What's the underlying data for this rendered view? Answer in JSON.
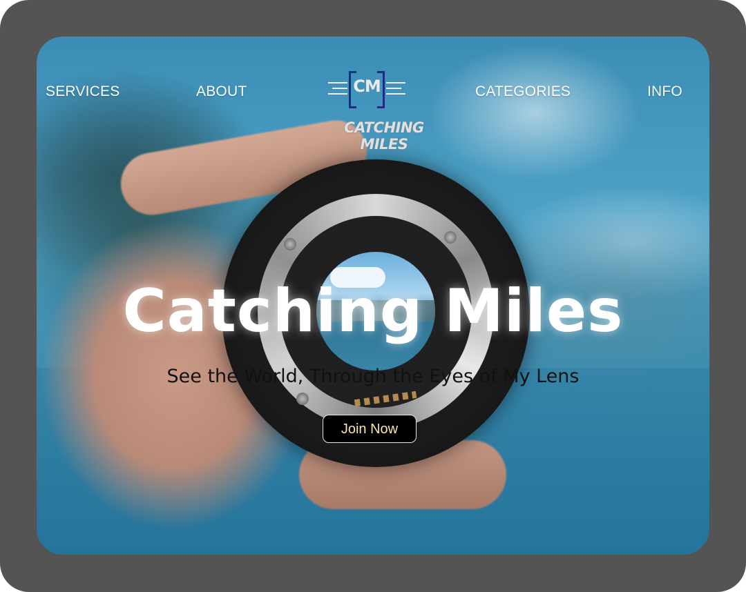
{
  "nav": {
    "items": [
      {
        "label": "SERVICES"
      },
      {
        "label": "ABOUT"
      },
      {
        "label": "CATEGORIES"
      },
      {
        "label": "INFO"
      }
    ]
  },
  "logo": {
    "initials": "CM",
    "name": "CATCHING MILES"
  },
  "hero": {
    "title": "Catching Miles",
    "subtitle": "See the World, Through the Eyes of My Lens",
    "button_label": "Join Now"
  },
  "colors": {
    "frame": "#545454",
    "logo_bracket": "#1d2b86",
    "button_bg": "#000000",
    "button_text": "#f7e4b0"
  }
}
